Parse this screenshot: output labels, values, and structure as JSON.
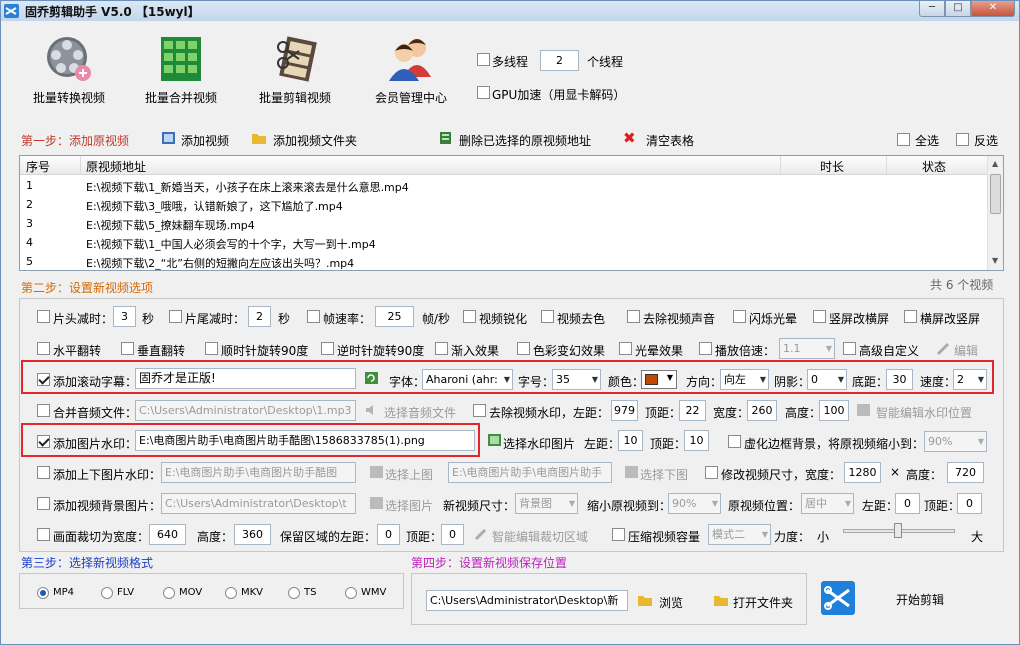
{
  "app": {
    "title": "固乔剪辑助手 V5.0  【15wyl】",
    "min": "─",
    "max": "□",
    "close": "✕"
  },
  "tools": [
    {
      "label": "批量转换视频",
      "icon": "film-reel-icon"
    },
    {
      "label": "批量合并视频",
      "icon": "merge-blocks-icon"
    },
    {
      "label": "批量剪辑视频",
      "icon": "film-strip-icon"
    },
    {
      "label": "会员管理中心",
      "icon": "users-icon"
    }
  ],
  "options": {
    "multithread_label": "多线程",
    "threads": "2",
    "threads_unit": "个线程",
    "gpu_label": "GPU加速（用显卡解码）"
  },
  "step1": {
    "label": "第一步：添加原视频",
    "add_video": "添加视频",
    "add_folder": "添加视频文件夹",
    "delete_selected": "删除已选择的原视频地址",
    "clear_table": "清空表格",
    "select_all": "全选",
    "invert": "反选"
  },
  "table": {
    "headers": [
      "序号",
      "原视频地址",
      "时长",
      "状态"
    ],
    "rows": [
      {
        "n": "1",
        "path": "E:\\视频下载\\1_新婚当天，小孩子在床上滚来滚去是什么意思.mp4"
      },
      {
        "n": "2",
        "path": "E:\\视频下载\\3_哦哦，认错新娘了，这下尴尬了.mp4"
      },
      {
        "n": "3",
        "path": "E:\\视频下载\\5_撩妹翻车现场.mp4"
      },
      {
        "n": "4",
        "path": "E:\\视频下载\\1_中国人必须会写的十个字，大写一到十.mp4"
      },
      {
        "n": "5",
        "path": "E:\\视频下载\\2_“北”右侧的短撇向左应该出头吗？.mp4"
      }
    ],
    "count": "共 6 个视频"
  },
  "step2": {
    "label": "第二步：设置新视频选项",
    "head_cut": "片头减时：",
    "head_val": "3",
    "sec": "秒",
    "tail_cut": "片尾减时：",
    "tail_val": "2",
    "fps_label": "帧速率：",
    "fps_val": "25",
    "fps_unit": "帧/秒",
    "sharpen": "视频锐化",
    "decolor": "视频去色",
    "mute": "去除视频声音",
    "flash": "闪烁光晕",
    "v2h": "竖屏改横屏",
    "h2v": "横屏改竖屏",
    "hflip": "水平翻转",
    "vflip": "垂直翻转",
    "cw90": "顺时针旋转90度",
    "ccw90": "逆时针旋转90度",
    "fadein": "渐入效果",
    "colorshift": "色彩变幻效果",
    "halo": "光晕效果",
    "speed": "播放倍速：",
    "speed_val": "1.1",
    "custom": "高级自定义",
    "edit": "编辑",
    "scroll_cb": "添加滚动字幕：",
    "scroll_text": "固乔才是正版!",
    "font_label": "字体：",
    "font_val": "Aharoni (ahr:",
    "size_label": "字号：",
    "size_val": "35",
    "color_label": "颜色：",
    "dir_label": "方向：",
    "dir_val": "向左",
    "shadow_label": "阴影：",
    "shadow_val": "0",
    "bottom_label": "底距：",
    "bottom_val": "30",
    "spd_label": "速度：",
    "spd_val": "2",
    "merge_audio": "合并音频文件：",
    "audio_path": "C:\\Users\\Administrator\\Desktop\\1.mp3",
    "select_audio": "选择音频文件",
    "rm_watermark": "去除视频水印，左距：",
    "wm_left": "979",
    "top_label": "顶距：",
    "wm_top": "22",
    "width_label": "宽度：",
    "wm_w": "260",
    "height_label": "高度：",
    "wm_h": "100",
    "smart_wm": "智能编辑水印位置",
    "img_wm": "添加图片水印：",
    "img_path": "E:\\电商图片助手\\电商图片助手酷图\\1586833785(1).png",
    "select_wm": "选择水印图片",
    "left_label": "左距：",
    "img_left": "10",
    "img_top": "10",
    "blur_bg": "虚化边框背景，将原视频缩小到：",
    "blur_val": "90%",
    "updown": "添加上下图片水印：",
    "up_path": "E:\\电商图片助手\\电商图片助手酷图",
    "select_up": "选择上图",
    "down_path": "E:\\电商图片助手\\电商图片助手",
    "select_down": "选择下图",
    "resize": "修改视频尺寸，宽度：",
    "rw": "1280",
    "times": "×",
    "rh_label": "高度：",
    "rh": "720",
    "bg_img": "添加视频背景图片：",
    "bg_path": "C:\\Users\\Administrator\\Desktop\\t",
    "select_img": "选择图片",
    "new_size": "新视频尺寸：",
    "new_size_val": "背景图",
    "shrink": "缩小原视频到：",
    "shrink_val": "90%",
    "pos_label": "原视频位置：",
    "pos_val": "居中",
    "bl_label": "左距：",
    "bl": "0",
    "bt_label": "顶距：",
    "bt": "0",
    "crop": "画面裁切为宽度：",
    "crop_w": "640",
    "crop_h_label": "高度：",
    "crop_h": "360",
    "keep_label": "保留区域的左距：",
    "keep_l": "0",
    "keep_t_label": "顶距：",
    "keep_t": "0",
    "smart_crop": "智能编辑裁切区域",
    "compress": "压缩视频容量",
    "mode_val": "模式二",
    "force": "力度：",
    "small": "小",
    "big": "大"
  },
  "step3": {
    "label": "第三步：选择新视频格式",
    "formats": [
      "MP4",
      "FLV",
      "MOV",
      "MKV",
      "TS",
      "WMV"
    ]
  },
  "step4": {
    "label": "第四步：设置新视频保存位置",
    "path": "C:\\Users\\Administrator\\Desktop\\新",
    "browse": "浏览",
    "open_folder": "打开文件夹",
    "start": "开始剪辑"
  }
}
